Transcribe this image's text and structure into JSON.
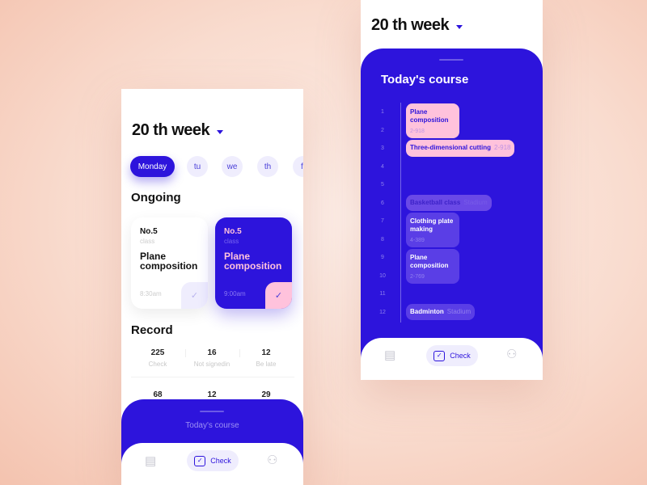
{
  "colors": {
    "accent": "#2d14dc",
    "pink": "#ffc2dc",
    "lavender": "#efedfd"
  },
  "left": {
    "week_title": "20 th week",
    "days": [
      {
        "label": "Monday",
        "active": true
      },
      {
        "label": "tu"
      },
      {
        "label": "we"
      },
      {
        "label": "th"
      },
      {
        "label": "f"
      }
    ],
    "ongoing_title": "Ongoing",
    "cards": [
      {
        "no": "No.5",
        "cls": "class",
        "name": "Plane composition",
        "time": "8:30am",
        "style": "white"
      },
      {
        "no": "No.5",
        "cls": "class",
        "name": "Plane composition",
        "time": "9:00am",
        "style": "blue"
      }
    ],
    "record_title": "Record",
    "stats_row1": [
      {
        "n": "225",
        "l": "Check"
      },
      {
        "n": "16",
        "l": "Not signedin"
      },
      {
        "n": "12",
        "l": "Be late"
      }
    ],
    "stats_row2": [
      {
        "n": "68"
      },
      {
        "n": "12"
      },
      {
        "n": "29"
      }
    ],
    "sheet_title": "Today's course",
    "nav": {
      "check_label": "Check"
    }
  },
  "right": {
    "week_title": "20 th week",
    "sheet_title": "Today's course",
    "periods": [
      "1",
      "2",
      "3",
      "4",
      "5",
      "6",
      "7",
      "8",
      "9",
      "10",
      "11",
      "12"
    ],
    "courses": [
      {
        "name": "Plane composition",
        "room": "2-918",
        "start": 1,
        "end": 2,
        "style": "pink",
        "layout": "stack"
      },
      {
        "name": "Three-dimensional cutting",
        "room": "2-918",
        "start": 3,
        "end": 3,
        "style": "pink",
        "layout": "inline"
      },
      {
        "name": "Basketball class",
        "room": "Stadium",
        "start": 6,
        "end": 6,
        "style": "faded",
        "layout": "inline"
      },
      {
        "name": "Clothing plate making",
        "room": "4-389",
        "start": 7,
        "end": 8,
        "style": "soft",
        "layout": "stack"
      },
      {
        "name": "Plane composition",
        "room": "2-769",
        "start": 9,
        "end": 10,
        "style": "soft",
        "layout": "stack"
      },
      {
        "name": "Badminton",
        "room": "Stadium",
        "start": 12,
        "end": 12,
        "style": "soft",
        "layout": "inline"
      }
    ],
    "nav": {
      "check_label": "Check"
    }
  }
}
